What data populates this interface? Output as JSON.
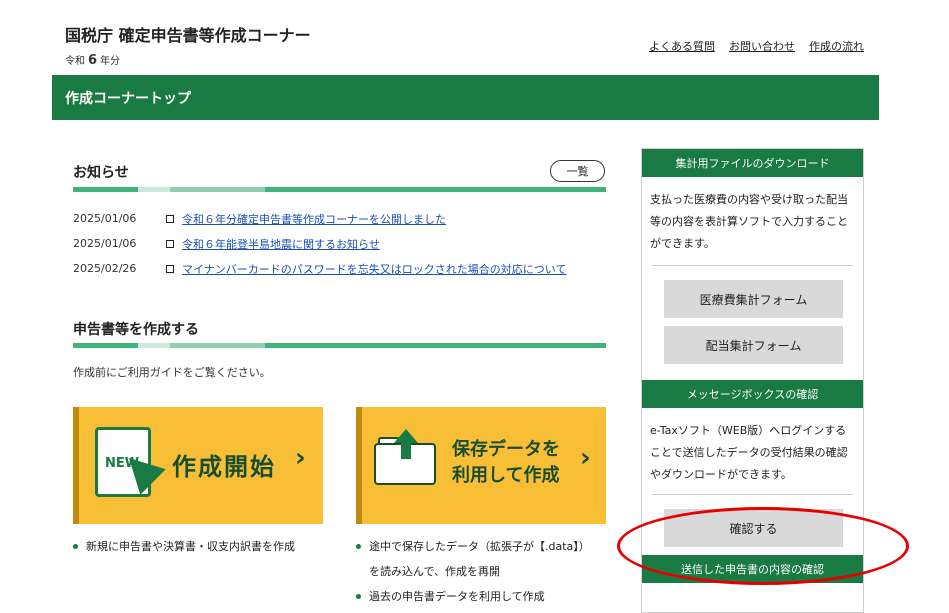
{
  "header": {
    "site_title": "国税庁 確定申告書等作成コーナー",
    "era_prefix": "令和",
    "era_number": "6",
    "era_suffix": "年分",
    "links": [
      "よくある質問",
      "お問い合わせ",
      "作成の流れ"
    ]
  },
  "nav": {
    "title": "作成コーナートップ"
  },
  "notices": {
    "title": "お知らせ",
    "list_button": "一覧",
    "items": [
      {
        "date": "2025/01/06",
        "text": "令和６年分確定申告書等作成コーナーを公開しました"
      },
      {
        "date": "2025/01/06",
        "text": "令和６年能登半島地震に関するお知らせ"
      },
      {
        "date": "2025/02/26",
        "text": "マイナンバーカードのパスワードを忘失又はロックされた場合の対応について"
      }
    ]
  },
  "create": {
    "title": "申告書等を作成する",
    "guide": "作成前にご利用ガイドをご覧ください。",
    "new_card": {
      "badge": "NEW",
      "label": "作成開始",
      "chevron": "›"
    },
    "load_card": {
      "label_line1": "保存データを",
      "label_line2": "利用して作成",
      "chevron": "›"
    },
    "new_bullets": [
      "新規に申告書や決算書・収支内訳書を作成"
    ],
    "load_bullets": [
      "途中で保存したデータ（拡張子が【.data】）",
      "を読み込んで、作成を再開",
      "過去の申告書データを利用して作成"
    ]
  },
  "sidebar": {
    "download": {
      "heading": "集計用ファイルのダウンロード",
      "body": "支払った医療費の内容や受け取った配当等の内容を表計算ソフトで入力することができます。",
      "buttons": [
        "医療費集計フォーム",
        "配当集計フォーム"
      ]
    },
    "message_box": {
      "heading": "メッセージボックスの確認",
      "body": "e-Taxソフト（WEB版）へログインすることで送信したデータの受付結果の確認やダウンロードができます。",
      "button": "確認する"
    },
    "next_heading": "送信した申告書の内容の確認"
  },
  "colors": {
    "brand_green": "#1a7a43",
    "card_yellow": "#f8bf36",
    "highlight_red": "#e60000"
  }
}
